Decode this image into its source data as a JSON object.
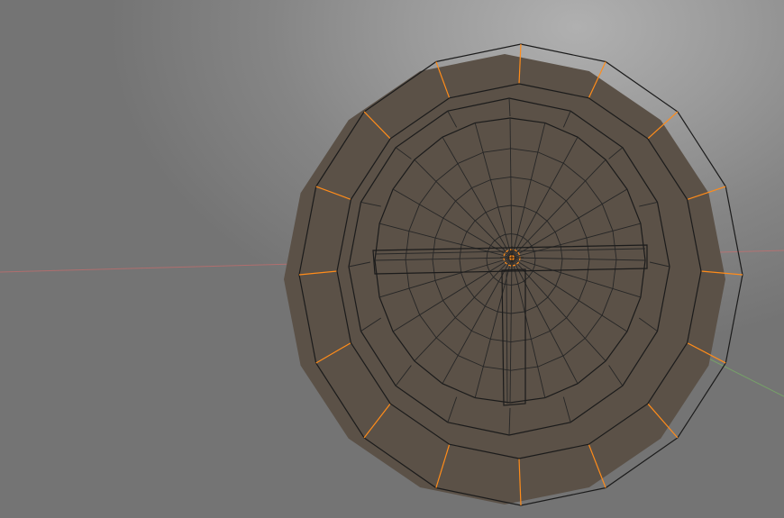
{
  "viewport": {
    "background_center": "#b0b0b0",
    "background_edge": "#747474"
  },
  "mesh": {
    "rim_segments": 16,
    "surface_color": "#c8b7a4",
    "shadow_color": "#5b5147",
    "seam_color": "#ff8c1a",
    "edge_color": "#1b1b1b"
  },
  "axes": {
    "x_axis_color": "#e06a6a",
    "y_axis_color": "#78c060"
  },
  "origin": {
    "marker_color": "#ff8c1a"
  }
}
